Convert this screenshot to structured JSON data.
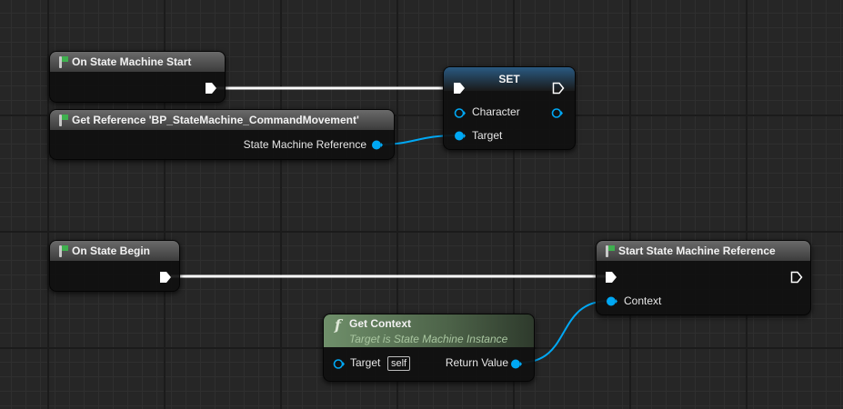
{
  "nodes": {
    "on_state_machine_start": {
      "title": "On State Machine Start"
    },
    "get_reference": {
      "title": "Get Reference 'BP_StateMachine_CommandMovement'",
      "output_label": "State Machine Reference"
    },
    "set": {
      "title": "SET",
      "character_label": "Character",
      "target_label": "Target"
    },
    "on_state_begin": {
      "title": "On State Begin"
    },
    "start_state_machine_reference": {
      "title": "Start State Machine Reference",
      "context_label": "Context"
    },
    "get_context": {
      "title": "Get Context",
      "subtitle": "Target is State Machine Instance",
      "target_label": "Target",
      "self_label": "self",
      "return_label": "Return Value"
    }
  },
  "colors": {
    "exec_wire": "#ffffff",
    "object_wire": "#00a8f4",
    "event_header": "#4e4e4e",
    "function_header": "#6f8f6a",
    "set_header": "#2a5a82"
  },
  "icons": {
    "event": "event-node-icon",
    "function": "function-f-icon",
    "exec": "exec-pin-arrow-icon",
    "object": "object-pin-circle-icon"
  }
}
